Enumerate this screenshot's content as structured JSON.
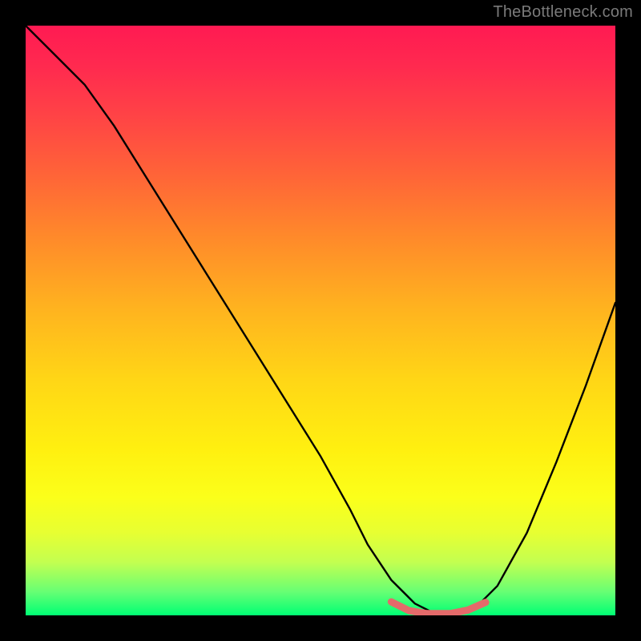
{
  "watermark": "TheBottleneck.com",
  "colors": {
    "frame_bg_top": "#ff1a52",
    "frame_bg_bottom": "#00ff74",
    "curve": "#000000",
    "highlight": "#e46a6a",
    "page_bg": "#000000"
  },
  "chart_data": {
    "type": "line",
    "title": "",
    "xlabel": "",
    "ylabel": "",
    "xlim": [
      0,
      100
    ],
    "ylim": [
      0,
      100
    ],
    "series": [
      {
        "name": "bottleneck-curve",
        "x": [
          0,
          4,
          7,
          10,
          15,
          20,
          25,
          30,
          35,
          40,
          45,
          50,
          55,
          58,
          62,
          66,
          70,
          73,
          76,
          80,
          85,
          90,
          95,
          100
        ],
        "y": [
          100,
          96,
          93,
          90,
          83,
          75,
          67,
          59,
          51,
          43,
          35,
          27,
          18,
          12,
          6,
          2,
          0,
          0,
          1,
          5,
          14,
          26,
          39,
          53
        ]
      }
    ],
    "highlight_segment": {
      "name": "optimal-range",
      "x": [
        62,
        65,
        68,
        72,
        75,
        78
      ],
      "y": [
        2.3,
        0.8,
        0.3,
        0.3,
        0.9,
        2.2
      ]
    }
  }
}
